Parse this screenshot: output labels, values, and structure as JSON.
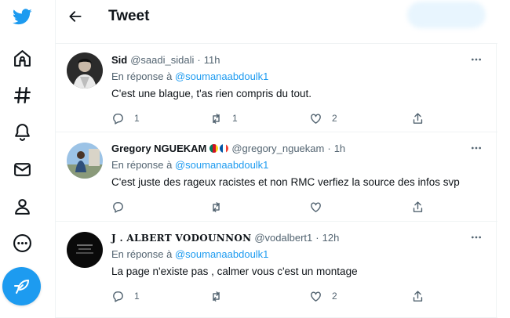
{
  "header": {
    "title": "Tweet"
  },
  "tweets": [
    {
      "name": "Sid",
      "handle": "@saadi_sidali",
      "separator": "·",
      "time": "11h",
      "reply_prefix": "En réponse à",
      "reply_to": "@soumanaabdoulk1",
      "text": "C'est une blague, t'as rien compris du tout.",
      "replies": "1",
      "retweets": "1",
      "likes": "2"
    },
    {
      "name": "Gregory NGUEKAM",
      "handle": "@gregory_nguekam",
      "separator": "·",
      "time": "1h",
      "reply_prefix": "En réponse à",
      "reply_to": "@soumanaabdoulk1",
      "text": "C'est juste des rageux racistes et non RMC verfiez la source des infos svp",
      "replies": "",
      "retweets": "",
      "likes": ""
    },
    {
      "name": "J . ALBERT VODOUNNON",
      "handle": "@vodalbert1",
      "separator": "·",
      "time": "12h",
      "reply_prefix": "En réponse à",
      "reply_to": "@soumanaabdoulk1",
      "text": "La page n'existe pas , calmer vous c'est un montage",
      "replies": "1",
      "retweets": "",
      "likes": "2"
    }
  ],
  "colors": {
    "accent": "#1d9bf0",
    "secondary_text": "#536471",
    "border": "#eff3f4"
  },
  "icons": {
    "sidebar": [
      "twitter-logo-icon",
      "home-icon",
      "hashtag-icon",
      "bell-icon",
      "mail-icon",
      "profile-icon",
      "more-circle-icon",
      "compose-feather-icon"
    ],
    "actions": [
      "reply-icon",
      "retweet-icon",
      "like-icon",
      "share-icon"
    ]
  }
}
